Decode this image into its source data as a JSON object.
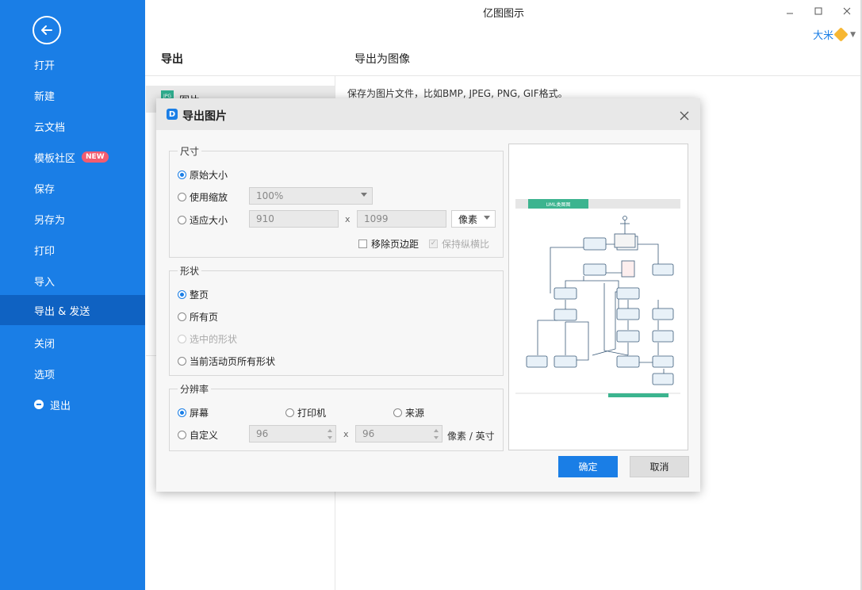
{
  "app": {
    "title": "亿图图示",
    "user_name": "大米"
  },
  "sidebar": {
    "items": [
      {
        "label": "打开"
      },
      {
        "label": "新建"
      },
      {
        "label": "云文档"
      },
      {
        "label": "模板社区",
        "badge": "NEW"
      },
      {
        "label": "保存"
      },
      {
        "label": "另存为"
      },
      {
        "label": "打印"
      },
      {
        "label": "导入"
      },
      {
        "label": "导出 & 发送"
      },
      {
        "label": "关闭"
      },
      {
        "label": "选项"
      },
      {
        "label": "退出"
      }
    ],
    "active_index": 8
  },
  "middle": {
    "header": "导出",
    "selected_item": "图片"
  },
  "right": {
    "header": "导出为图像",
    "description": "保存为图片文件，比如BMP, JPEG, PNG, GIF格式。"
  },
  "dialog": {
    "title": "导出图片",
    "size_group": {
      "title": "尺寸",
      "original": "原始大小",
      "zoom": "使用缩放",
      "zoom_value": "100%",
      "fit": "适应大小",
      "width": "910",
      "height": "1099",
      "times": "x",
      "unit": "像素",
      "remove_margin": "移除页边距",
      "keep_ratio": "保持纵横比"
    },
    "shape_group": {
      "title": "形状",
      "whole_page": "整页",
      "all_pages": "所有页",
      "selected_shapes": "选中的形状",
      "active_page_shapes": "当前活动页所有形状"
    },
    "resolution_group": {
      "title": "分辨率",
      "screen": "屏幕",
      "printer": "打印机",
      "source": "来源",
      "custom": "自定义",
      "dpi_x": "96",
      "dpi_y": "96",
      "times": "x",
      "unit": "像素 / 英寸"
    },
    "preview": {
      "banner_title": "UML类图图"
    },
    "ok": "确定",
    "cancel": "取消"
  },
  "colors": {
    "accent": "#1a7ee6",
    "sidebar": "#1a7ee6",
    "active": "#0f62c2",
    "preview_green": "#3cb48f"
  }
}
